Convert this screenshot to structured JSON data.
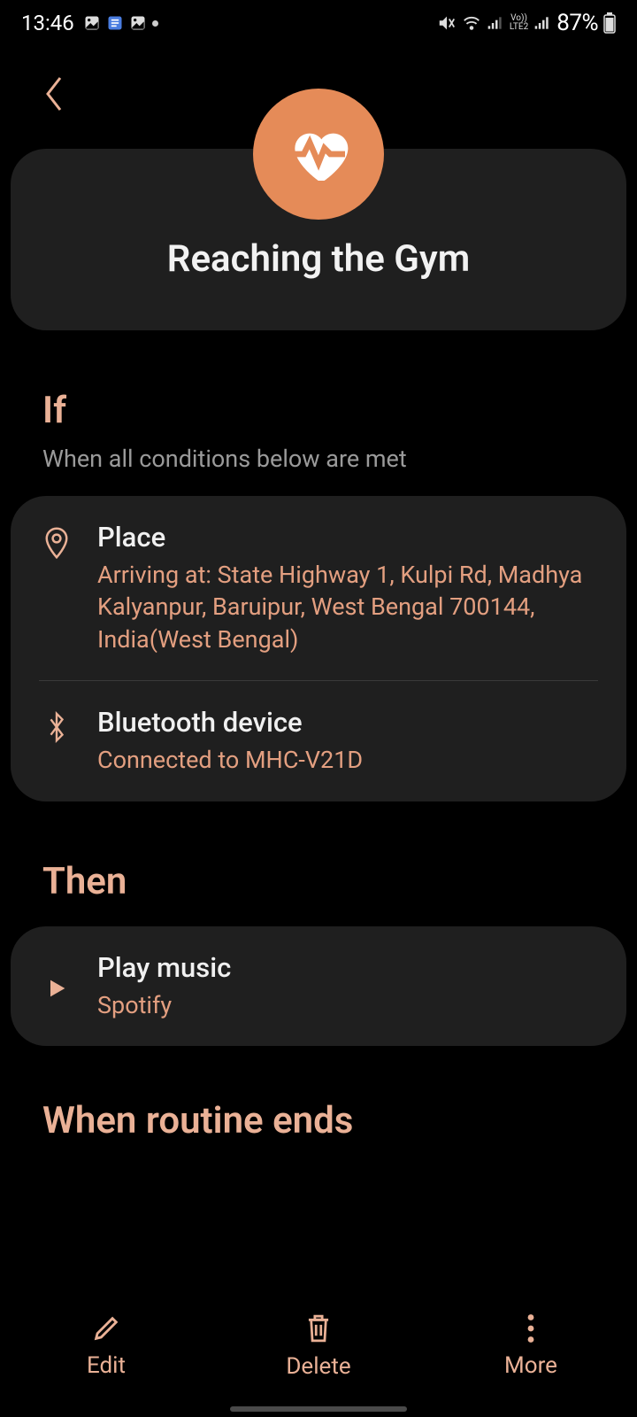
{
  "status": {
    "time": "13:46",
    "battery": "87%"
  },
  "routine": {
    "title": "Reaching the Gym"
  },
  "if_section": {
    "title": "If",
    "subtitle": "When all conditions below are met",
    "conditions": [
      {
        "title": "Place",
        "desc": "Arriving at: State Highway 1, Kulpi Rd, Madhya Kalyanpur, Baruipur, West Bengal 700144, India(West Bengal)"
      },
      {
        "title": "Bluetooth device",
        "desc": "Connected to MHC-V21D"
      }
    ]
  },
  "then_section": {
    "title": "Then",
    "actions": [
      {
        "title": "Play music",
        "desc": "Spotify"
      }
    ]
  },
  "ends_section": {
    "title": "When routine ends"
  },
  "bottom": {
    "edit": "Edit",
    "delete": "Delete",
    "more": "More"
  }
}
